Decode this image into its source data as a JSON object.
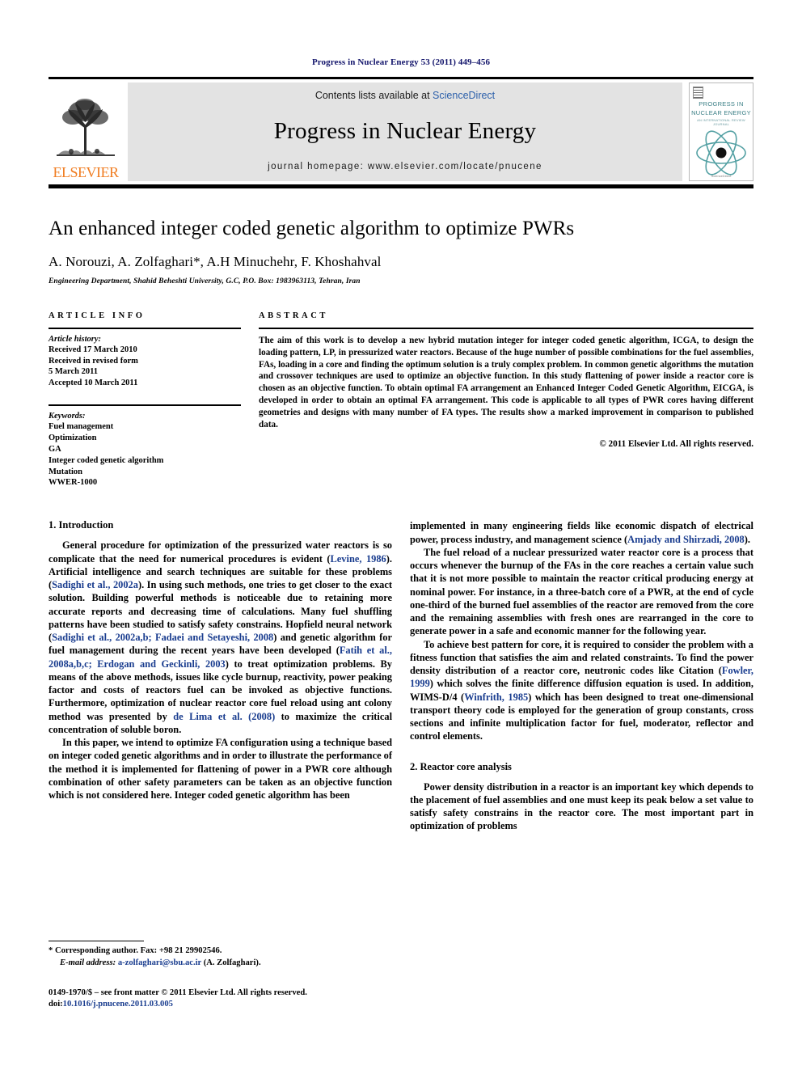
{
  "running_head": "Progress in Nuclear Energy 53 (2011) 449–456",
  "masthead": {
    "publisher_name": "ELSEVIER",
    "contents_prefix": "Contents lists available at ",
    "contents_link": "ScienceDirect",
    "journal_name": "Progress in Nuclear Energy",
    "homepage_line": "journal homepage: www.elsevier.com/locate/pnucene",
    "cover": {
      "title_line1": "PROGRESS IN",
      "title_line2": "NUCLEAR ENERGY",
      "subtitle": "AN INTERNATIONAL REVIEW JOURNAL",
      "footer": "ScienceDirect"
    }
  },
  "article": {
    "title": "An enhanced integer coded genetic algorithm to optimize PWRs",
    "authors": "A. Norouzi, A. Zolfaghari*, A.H Minuchehr, F. Khoshahval",
    "affiliation": "Engineering Department, Shahid Beheshti University, G.C, P.O. Box: 1983963113, Tehran, Iran"
  },
  "article_info": {
    "label": "ARTICLE INFO",
    "history_heading": "Article history:",
    "history_lines": [
      "Received 17 March 2010",
      "Received in revised form",
      "5 March 2011",
      "Accepted 10 March 2011"
    ],
    "keywords_heading": "Keywords:",
    "keywords": [
      "Fuel management",
      "Optimization",
      "GA",
      "Integer coded genetic algorithm",
      "Mutation",
      "WWER-1000"
    ]
  },
  "abstract": {
    "label": "ABSTRACT",
    "text": "The aim of this work is to develop a new hybrid mutation integer for integer coded genetic algorithm, ICGA, to design the loading pattern, LP, in pressurized water reactors. Because of the huge number of possible combinations for the fuel assemblies, FAs, loading in a core and finding the optimum solution is a truly complex problem. In common genetic algorithms the mutation and crossover techniques are used to optimize an objective function. In this study flattening of power inside a reactor core is chosen as an objective function. To obtain optimal FA arrangement an Enhanced Integer Coded Genetic Algorithm, EICGA, is developed in order to obtain an optimal FA arrangement. This code is applicable to all types of PWR cores having different geometries and designs with many number of FA types. The results show a marked improvement in comparison to published data.",
    "copyright": "© 2011 Elsevier Ltd. All rights reserved."
  },
  "sections": {
    "introduction_title": "1. Introduction",
    "reactor_title": "2. Reactor core analysis",
    "intro_p1_a": "General procedure for optimization of the pressurized water reactors is so complicate that the need for numerical procedures is evident (",
    "intro_p1_c1": "Levine, 1986",
    "intro_p1_b": "). Artificial intelligence and search techniques are suitable for these problems (",
    "intro_p1_c2": "Sadighi et al., 2002a",
    "intro_p1_d": "). In using such methods, one tries to get closer to the exact solution. Building powerful methods is noticeable due to retaining more accurate reports and decreasing time of calculations. Many fuel shuffling patterns have been studied to satisfy safety constrains. Hopfield neural network (",
    "intro_p1_c3": "Sadighi et al., 2002a,b; Fadaei and Setayeshi, 2008",
    "intro_p1_e": ") and genetic algorithm for fuel management during the recent years have been developed (",
    "intro_p1_c4": "Fatih et al., 2008a,b,c; Erdogan and Geckinli, 2003",
    "intro_p1_f": ") to treat optimization problems. By means of the above methods, issues like cycle burnup, reactivity, power peaking factor and costs of reactors fuel can be invoked as objective functions. Furthermore, optimization of nuclear reactor core fuel reload using ant colony method was presented by ",
    "intro_p1_c5": "de Lima et al. (2008)",
    "intro_p1_g": " to maximize the critical concentration of soluble boron.",
    "intro_p2": "In this paper, we intend to optimize FA configuration using a technique based on integer coded genetic algorithms and in order to illustrate the performance of the method it is implemented for flattening of power in a PWR core although combination of other safety parameters can be taken as an objective function which is not considered here. Integer coded genetic algorithm has been",
    "right_p1_a": "implemented in many engineering fields like economic dispatch of electrical power, process industry, and management science (",
    "right_p1_c1": "Amjady and Shirzadi, 2008",
    "right_p1_b": ").",
    "right_p2": "The fuel reload of a nuclear pressurized water reactor core is a process that occurs whenever the burnup of the FAs in the core reaches a certain value such that it is not more possible to maintain the reactor critical producing energy at nominal power. For instance, in a three-batch core of a PWR, at the end of cycle one-third of the burned fuel assemblies of the reactor are removed from the core and the remaining assemblies with fresh ones are rearranged in the core to generate power in a safe and economic manner for the following year.",
    "right_p3_a": "To achieve best pattern for core, it is required to consider the problem with a fitness function that satisfies the aim and related constraints. To find the power density distribution of a reactor core, neutronic codes like Citation (",
    "right_p3_c1": "Fowler, 1999",
    "right_p3_b": ") which solves the finite difference diffusion equation is used. In addition, WIMS-D/4 (",
    "right_p3_c2": "Winfrith, 1985",
    "right_p3_c": ") which has been designed to treat one-dimensional transport theory code is employed for the generation of group constants, cross sections and infinite multiplication factor for fuel, moderator, reflector and control elements.",
    "right_p4": "Power density distribution in a reactor is an important key which depends to the placement of fuel assemblies and one must keep its peak below a set value to satisfy safety constrains in the reactor core. The most important part in optimization of problems"
  },
  "footnotes": {
    "corresponding": "* Corresponding author. Fax: +98 21 29902546.",
    "email_label": "E-mail address:",
    "email": "a-zolfaghari@sbu.ac.ir",
    "email_suffix": " (A. Zolfaghari).",
    "issn_line": "0149-1970/$ – see front matter © 2011 Elsevier Ltd. All rights reserved.",
    "doi_label": "doi:",
    "doi_value": "10.1016/j.pnucene.2011.03.005"
  },
  "colors": {
    "running_head": "#12146b",
    "citation_blue": "#1a3d8f",
    "sciencedirect_blue": "#2b5faa",
    "elsevier_orange": "#f07c20",
    "band_gray": "#e3e3e3",
    "cover_teal": "#3b7f86"
  }
}
